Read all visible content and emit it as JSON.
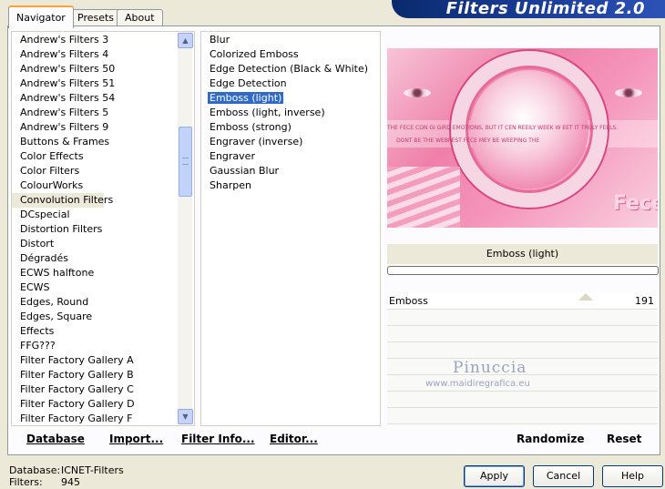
{
  "tabs": [
    "Navigator",
    "Presets",
    "About"
  ],
  "app_title": "Filters Unlimited 2.0",
  "categories": [
    "Andrew's Filters 3",
    "Andrew's Filters 4",
    "Andrew's Filters 50",
    "Andrew's Filters 51",
    "Andrew's Filters 54",
    "Andrew's Filters 5",
    "Andrew's Filters 9",
    "Buttons & Frames",
    "Color Effects",
    "Color Filters",
    "ColourWorks",
    "Convolution Filters",
    "DCspecial",
    "Distortion Filters",
    "Distort",
    "Dégradés",
    "ECWS halftone",
    "ECWS",
    "Edges, Round",
    "Edges, Square",
    "Effects",
    "FFG???",
    "Filter Factory Gallery A",
    "Filter Factory Gallery B",
    "Filter Factory Gallery C",
    "Filter Factory Gallery D",
    "Filter Factory Gallery F"
  ],
  "selected_category": "Convolution Filters",
  "filters": [
    "Blur",
    "Colorized Emboss",
    "Edge Detection (Black & White)",
    "Edge Detection",
    "Emboss (light)",
    "Emboss (light, inverse)",
    "Emboss (strong)",
    "Engraver (inverse)",
    "Engraver",
    "Gaussian Blur",
    "Sharpen"
  ],
  "selected_filter": "Emboss (light)",
  "preview_filter_name": "Emboss (light)",
  "preview_text_line1": "THE FECE CON GI   GIRD EMOTIONS, BUT IT CEN REEILY WEEK W   EET IT TRULY FEELS.",
  "preview_text_line2": "DONT BE        THE WEBPEST FECE MEY BE WEEPING THE",
  "preview_logo_text": "Fece",
  "parameters": [
    {
      "name": "Emboss",
      "value": "191"
    }
  ],
  "watermark": {
    "name": "Pinuccia",
    "url": "www.maidiregrafica.eu"
  },
  "bottom_buttons": {
    "database": "Database",
    "import": "Import...",
    "filter_info": "Filter Info...",
    "editor": "Editor...",
    "randomize": "Randomize",
    "reset": "Reset"
  },
  "status": {
    "database_label": "Database:",
    "database_value": "ICNET-Filters",
    "filters_label": "Filters:",
    "filters_value": "945"
  },
  "dialog_buttons": {
    "apply": "Apply",
    "cancel": "Cancel",
    "help": "Help"
  },
  "colors": {
    "selection": "#316ac5",
    "banner": "#1c3f9c",
    "preview_pink": "#ef7fa8"
  }
}
